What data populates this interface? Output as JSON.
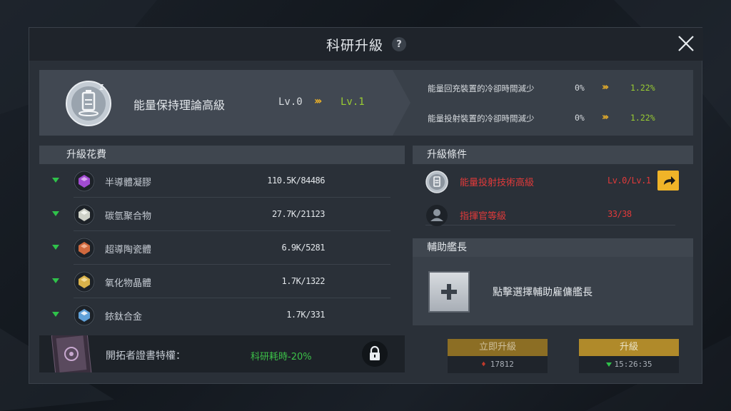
{
  "window": {
    "title": "科研升級",
    "help_icon": "?",
    "close_icon": "close-icon"
  },
  "skill": {
    "name": "能量保持理論高級",
    "level_from": "Lv.0",
    "arrows": "›››",
    "level_to": "Lv.1",
    "effects": [
      {
        "label": "能量回充裝置的冷卻時間減少",
        "from": "0%",
        "arrows": "›››",
        "to": "1.22%"
      },
      {
        "label": "能量投射裝置的冷卻時間減少",
        "from": "0%",
        "arrows": "›››",
        "to": "1.22%"
      }
    ]
  },
  "cost": {
    "header": "升級花費",
    "items": [
      {
        "name": "半導體凝膠",
        "value": "110.5K/84486",
        "icon": "gel-crystal-icon",
        "color": "#a14bd1"
      },
      {
        "name": "碳氫聚合物",
        "value": "27.7K/21123",
        "icon": "polymer-crystal-icon",
        "color": "#cfd2c8"
      },
      {
        "name": "超導陶瓷體",
        "value": "6.9K/5281",
        "icon": "ceramic-crystal-icon",
        "color": "#d0693e"
      },
      {
        "name": "氧化物晶體",
        "value": "1.7K/1322",
        "icon": "oxide-crystal-icon",
        "color": "#d9b24a"
      },
      {
        "name": "銥鈦合金",
        "value": "1.7K/331",
        "icon": "alloy-crystal-icon",
        "color": "#5fa0d8"
      }
    ]
  },
  "pioneer": {
    "label": "開拓者證書特權：",
    "bonus": "科研耗時-20%",
    "lock_icon": "lock-icon"
  },
  "conditions": {
    "header": "升級條件",
    "items": [
      {
        "name": "能量投射技術高級",
        "value": "Lv.0/Lv.1",
        "icon": "research-icon"
      },
      {
        "name": "指揮官等級",
        "value": "33/38",
        "icon": "commander-icon"
      }
    ]
  },
  "assistant": {
    "header": "輔助艦長",
    "hint": "點擊選擇輔助雇傭艦長"
  },
  "actions": {
    "instant": {
      "label": "立即升級",
      "cost": "17812"
    },
    "normal": {
      "label": "升級",
      "time": "15:26:35"
    }
  },
  "colors": {
    "accent_gold": "#f0b428",
    "level_green": "#9acd32",
    "warning_red": "#e03a3a",
    "available_green": "#2fc24a"
  }
}
